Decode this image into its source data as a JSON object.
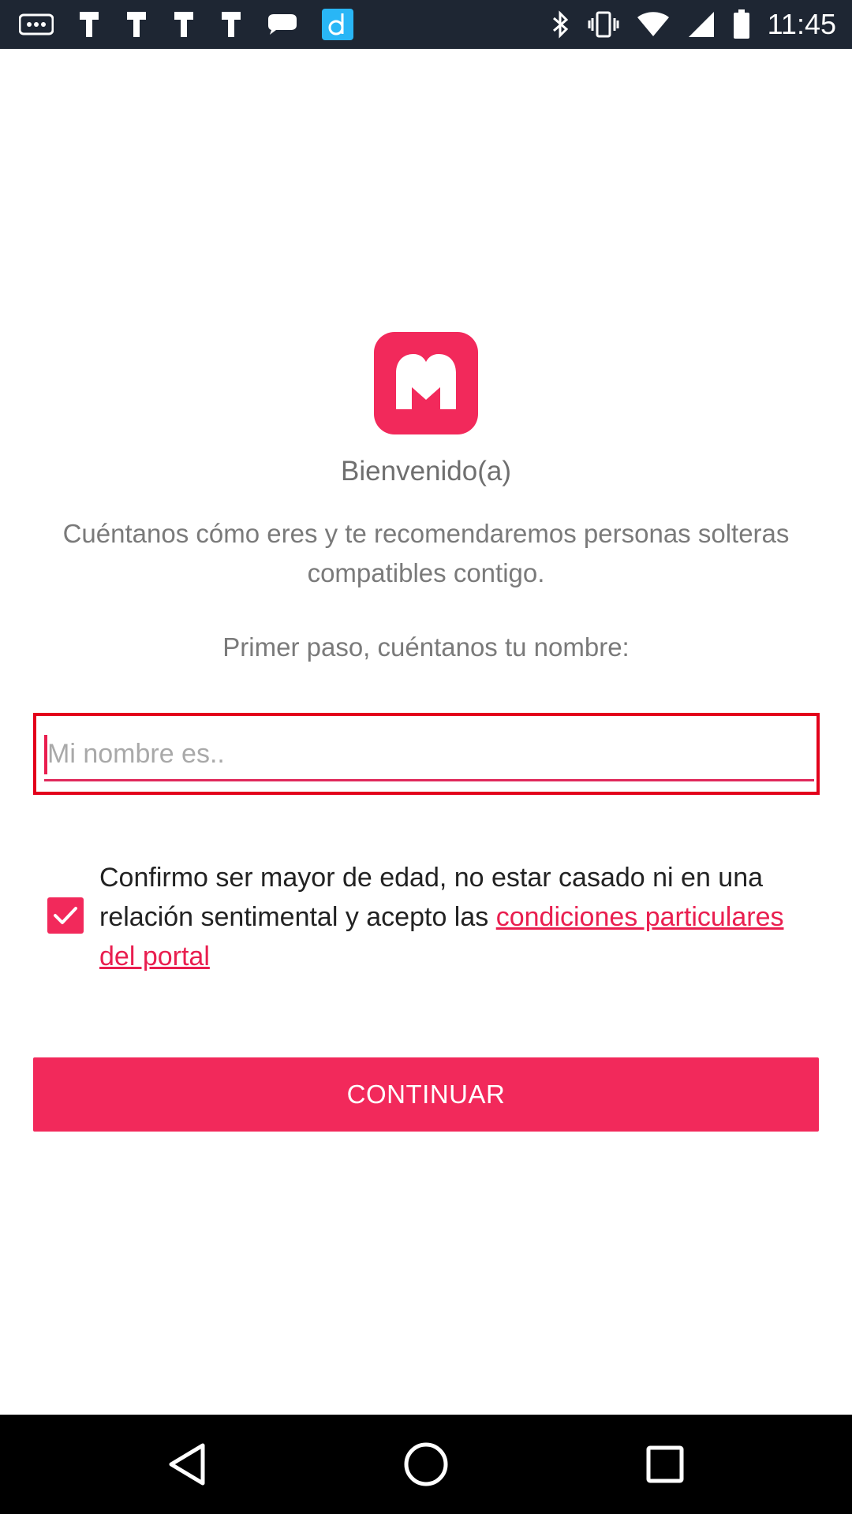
{
  "status_bar": {
    "time": "11:45",
    "left_icons": [
      "more-notifications-icon",
      "app-notification-icon",
      "app-notification-icon",
      "app-notification-icon",
      "app-notification-icon",
      "message-icon",
      "d-app-icon"
    ],
    "right_icons": [
      "bluetooth-icon",
      "vibrate-icon",
      "wifi-icon",
      "signal-icon",
      "battery-icon"
    ]
  },
  "logo": {
    "icon": "app-logo-icon",
    "color": "#f2295b"
  },
  "welcome_title": "Bienvenido(a)",
  "intro_text": "Cuéntanos cómo eres y te recomendaremos personas solteras compatibles contigo.",
  "step_text": "Primer paso, cuéntanos tu nombre:",
  "name_field": {
    "placeholder": "Mi nombre es..",
    "value": ""
  },
  "consent": {
    "checked": true,
    "text": "Confirmo ser mayor de edad, no estar casado ni en una relación sentimental y acepto las ",
    "link_text": "condiciones particulares del portal"
  },
  "continue_label": "CONTINUAR",
  "colors": {
    "accent": "#f2295b",
    "focus_frame": "#e3001b",
    "status_bar": "#1e2633",
    "nav_bar": "#000000"
  },
  "nav_bar": {
    "buttons": [
      "back-icon",
      "home-icon",
      "recents-icon"
    ]
  }
}
